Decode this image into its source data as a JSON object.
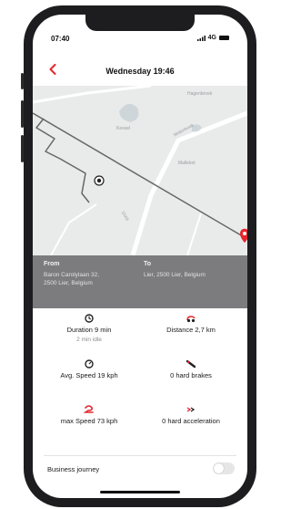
{
  "status": {
    "time": "07:40",
    "network": "4G"
  },
  "header": {
    "title": "Wednesday 19:46"
  },
  "map": {
    "labels": [
      "Hagenbroek",
      "Kessel",
      "Molenhoek",
      "Mallekot",
      "Dorp"
    ]
  },
  "route": {
    "from_label": "From",
    "from_line1": "Baron Carolylaan 32,",
    "from_line2": "2500 Lier, Belgium",
    "to_label": "To",
    "to_line1": "Lier, 2500 Lier, Belgium"
  },
  "stats": {
    "duration": "Duration 9 min",
    "idle": "2 min idle",
    "distance": "Distance 2,7 km",
    "avg_speed": "Avg. Speed 19 kph",
    "hard_brakes": "0 hard brakes",
    "max_speed": "max Speed 73 kph",
    "hard_acceleration": "0 hard acceleration"
  },
  "business": {
    "label": "Business journey",
    "enabled": false
  },
  "colors": {
    "accent": "#e3262d",
    "route_panel": "#7c7c7e",
    "map_bg": "#e9eaea",
    "route_line": "#666666"
  },
  "icons": [
    "chevron-left-icon",
    "clock-icon",
    "car-icon",
    "speedometer-icon",
    "brake-icon",
    "max-speed-icon",
    "acceleration-icon",
    "map-pin-icon"
  ]
}
